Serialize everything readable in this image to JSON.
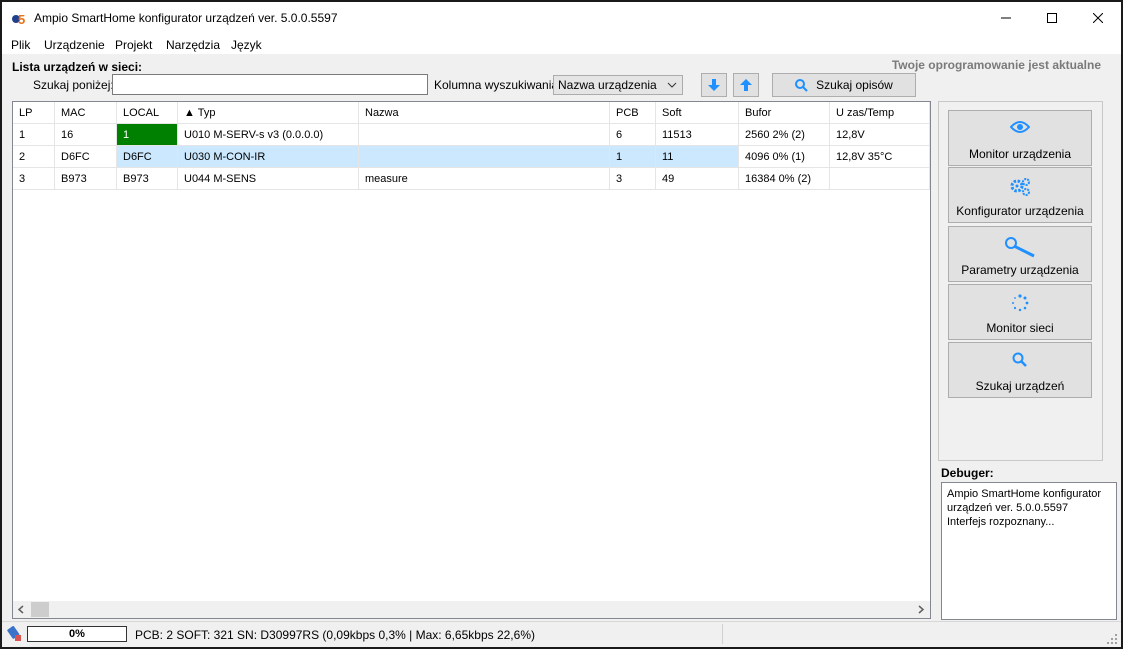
{
  "window": {
    "title": "Ampio SmartHome konfigurator urządzeń ver. 5.0.0.5597",
    "minimize_icon": "minimize-icon",
    "maximize_icon": "maximize-icon",
    "close_icon": "close-icon"
  },
  "menu": [
    "Plik",
    "Urządzenie",
    "Projekt",
    "Narzędzia",
    "Język"
  ],
  "header": {
    "list_label": "Lista urządzeń w sieci:",
    "update_status": "Twoje oprogramowanie jest aktualne"
  },
  "search": {
    "label": "Szukaj poniżej:",
    "value": "",
    "column_label": "Kolumna wyszukiwania:",
    "column_value": "Nazwa urządzenia",
    "down_icon": "arrow-down-icon",
    "up_icon": "arrow-up-icon",
    "descriptions_button": "Szukaj opisów"
  },
  "table": {
    "columns": [
      "LP",
      "MAC",
      "LOCAL",
      "▲ Typ",
      "Nazwa",
      "PCB",
      "Soft",
      "Bufor",
      "U zas/Temp"
    ],
    "rows": [
      [
        "1",
        "16",
        "1",
        "U010 M-SERV-s v3 (0.0.0.0)",
        "",
        "6",
        "11513",
        "2560 2% (2)",
        "12,8V"
      ],
      [
        "2",
        "D6FC",
        "D6FC",
        "U030 M-CON-IR",
        "",
        "1",
        "11",
        "4096 0% (1)",
        "12,8V 35°C"
      ],
      [
        "3",
        "B973",
        "B973",
        "U044 M-SENS",
        "measure",
        "3",
        "49",
        "16384 0% (2)",
        ""
      ]
    ],
    "selected_row": 2,
    "local_highlight_color": "#008000"
  },
  "actions": [
    {
      "label": "Monitor urządzenia",
      "icon": "eye-icon"
    },
    {
      "label": "Konfigurator urządzenia",
      "icon": "gears-icon"
    },
    {
      "label": "Parametry urządzenia",
      "icon": "wrench-icon"
    },
    {
      "label": "Monitor sieci",
      "icon": "spinner-icon"
    },
    {
      "label": "Szukaj urządzeń",
      "icon": "search-icon"
    }
  ],
  "debugger": {
    "label": "Debuger:",
    "lines": [
      "Ampio SmartHome konfigurator",
      "urządzeń ver. 5.0.0.5597",
      "Interfejs rozpoznany..."
    ]
  },
  "statusbar": {
    "progress": "0%",
    "info": "PCB: 2 SOFT: 321 SN: D30997RS (0,09kbps 0,3% | Max: 6,65kbps 22,6%)"
  },
  "colors": {
    "accent": "#0078d7",
    "selection": "#cce8ff"
  }
}
